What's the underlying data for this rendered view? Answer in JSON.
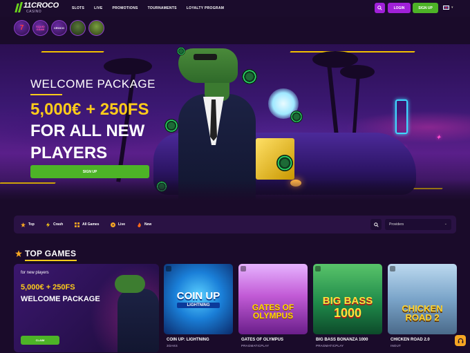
{
  "header": {
    "logo_main": "11CROCO",
    "logo_sub": "CASINO",
    "nav": [
      "SLOTS",
      "LIVE",
      "PROMOTIONS",
      "TOURNAMENTS",
      "LOYALTY PROGRAM"
    ],
    "login_label": "LOGIN",
    "signup_label": "SIGN UP"
  },
  "promos": [
    {
      "label": "7"
    },
    {
      "label": "SQUID GAME"
    },
    {
      "label": "CROCO"
    },
    {
      "label": ""
    },
    {
      "label": ""
    }
  ],
  "hero": {
    "line1": "WELCOME PACKAGE",
    "line2": "5,000€ + 250FS",
    "line3": "FOR ALL NEW",
    "line4": "PLAYERS",
    "button": "SIGN UP"
  },
  "filters": {
    "items": [
      "Top",
      "Crash",
      "All Games",
      "Live",
      "New"
    ],
    "providers_label": "Providers"
  },
  "top_games": {
    "title": "TOP GAMES",
    "welcome_card": {
      "small": "for new players",
      "line1": "5,000€ + 250FS",
      "line2": "WELCOME PACKAGE",
      "button": "CLAIM"
    },
    "games": [
      {
        "name": "COIN UP: LIGHTNING",
        "provider": "3OAKS",
        "art_title": "COIN UP",
        "art_sub": "LIGHTNING",
        "color": "#1aa7e8"
      },
      {
        "name": "GATES OF OLYMPUS",
        "provider": "PRAGMATICPLAY",
        "art_title": "GATES OF OLYMPUS",
        "art_sub": "",
        "color": "#c25bd6"
      },
      {
        "name": "BIG BASS BONANZA 1000",
        "provider": "PRAGMATICPLAY",
        "art_title": "BIG BASS",
        "art_sub": "1000",
        "color": "#2aa85a"
      },
      {
        "name": "CHICKEN ROAD 2.0",
        "provider": "INOUT",
        "art_title": "CHICKEN ROAD 2",
        "art_sub": "",
        "color": "#7aa4c9"
      }
    ]
  }
}
